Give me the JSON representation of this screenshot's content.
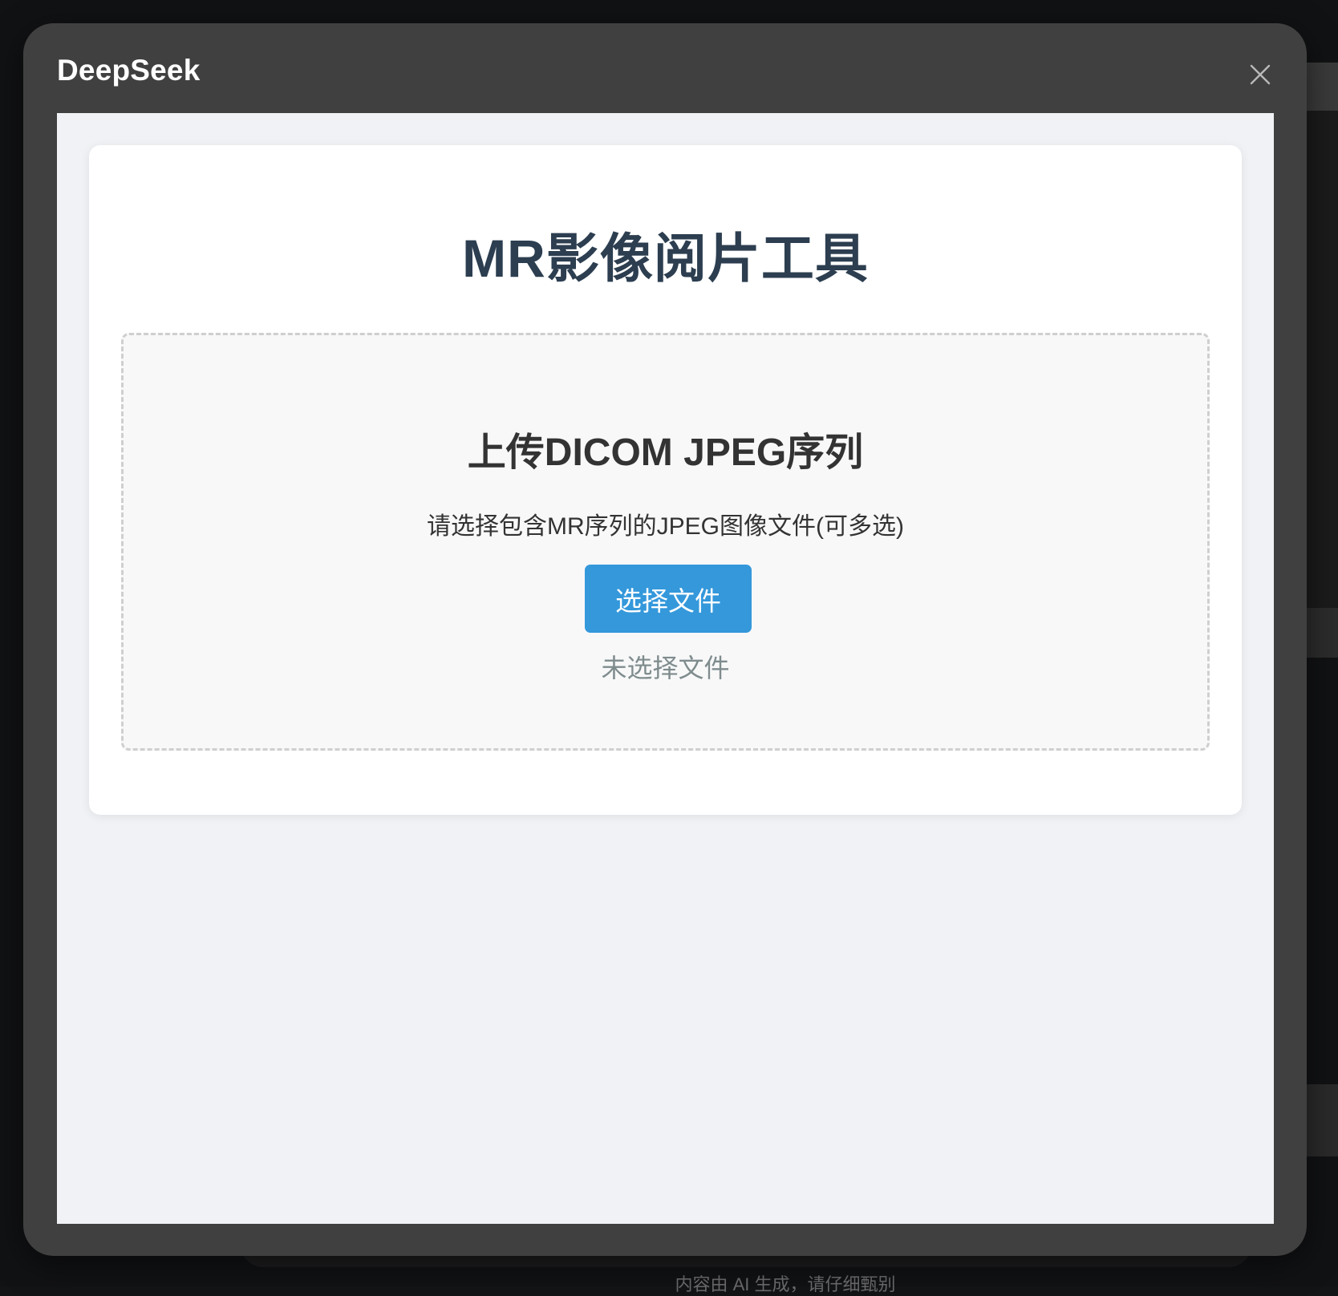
{
  "modal": {
    "title": "DeepSeek"
  },
  "page": {
    "title": "MR影像阅片工具"
  },
  "upload": {
    "heading": "上传DICOM JPEG序列",
    "description": "请选择包含MR序列的JPEG图像文件(可多选)",
    "button_label": "选择文件",
    "status": "未选择文件"
  },
  "background": {
    "footer_text": "内容由 AI 生成，请仔细甄别"
  },
  "colors": {
    "accent": "#3498db",
    "title": "#2c3e50",
    "modal_bg": "#404040"
  },
  "icons": {
    "close": "close-icon"
  }
}
